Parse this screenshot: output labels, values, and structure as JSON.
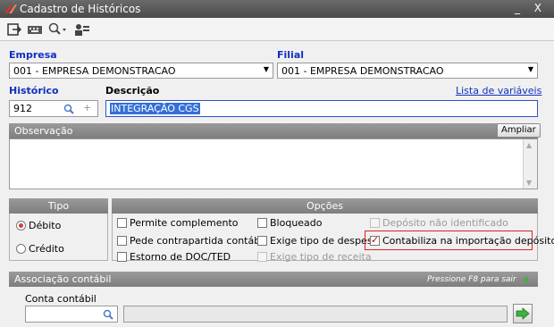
{
  "window": {
    "title": "Cadastro de Históricos",
    "controls": "_ X"
  },
  "toolbar": {
    "icons": [
      "exit-icon",
      "keyboard-icon",
      "search-icon",
      "users-icon"
    ]
  },
  "empresa": {
    "label": "Empresa",
    "value": "001 - EMPRESA DEMONSTRACAO"
  },
  "filial": {
    "label": "Filial",
    "value": "001 - EMPRESA DEMONSTRACAO"
  },
  "historico": {
    "label": "Histórico",
    "value": "912"
  },
  "descricao": {
    "label": "Descrição",
    "value": "INTEGRAÇÃO CGS"
  },
  "variables_link": "Lista de variáveis",
  "observacao": {
    "label": "Observação",
    "expand_label": "Ampliar"
  },
  "tipo": {
    "title": "Tipo",
    "options": [
      {
        "label": "Débito",
        "selected": true
      },
      {
        "label": "Crédito",
        "selected": false
      }
    ]
  },
  "opcoes": {
    "title": "Opções",
    "items": [
      {
        "label": "Permite complemento",
        "checked": false,
        "enabled": true
      },
      {
        "label": "Pede contrapartida contábil",
        "checked": false,
        "enabled": true
      },
      {
        "label": "Estorno de DOC/TED",
        "checked": false,
        "enabled": true
      },
      {
        "label": "Bloqueado",
        "checked": false,
        "enabled": true
      },
      {
        "label": "Exige tipo de despesa",
        "checked": false,
        "enabled": true
      },
      {
        "label": "Exige tipo de receita",
        "checked": false,
        "enabled": false
      },
      {
        "label": "Depósito não identificado",
        "checked": false,
        "enabled": false
      },
      {
        "label": "Contabiliza na importação depósito",
        "checked": true,
        "enabled": true
      }
    ]
  },
  "associacao": {
    "title": "Associação contábil",
    "hint": "Pressione F8 para sair",
    "conta_label": "Conta contábil",
    "conta_value": "",
    "description_value": ""
  },
  "colors": {
    "accent": "#1030c0",
    "highlight": "#e02020"
  }
}
